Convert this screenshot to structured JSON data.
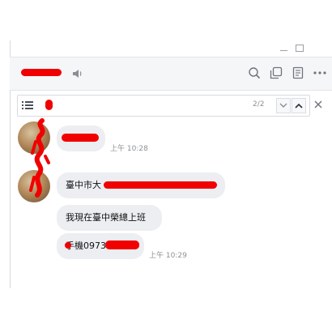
{
  "window": {
    "controls": {
      "minimize": "—",
      "maximize": "□"
    }
  },
  "header": {
    "contact_name": "████",
    "icons": [
      "speaker-icon",
      "search-icon",
      "copy-window-icon",
      "notes-icon",
      "more-icon"
    ]
  },
  "search": {
    "value": "",
    "count": "2/2",
    "icons": [
      "list-icon",
      "chevron-down-icon",
      "chevron-up-icon",
      "close-icon"
    ]
  },
  "messages": [
    {
      "text": "",
      "time": "上午 10:28"
    },
    {
      "text": "臺中市大",
      "time": ""
    },
    {
      "text": "我現在臺中榮總上班",
      "time": ""
    },
    {
      "text": "手機0973",
      "time": "上午 10:29"
    }
  ],
  "colors": {
    "redaction": "#f00000",
    "bubble": "#eceef1",
    "header_bg": "#f4f6f8"
  }
}
